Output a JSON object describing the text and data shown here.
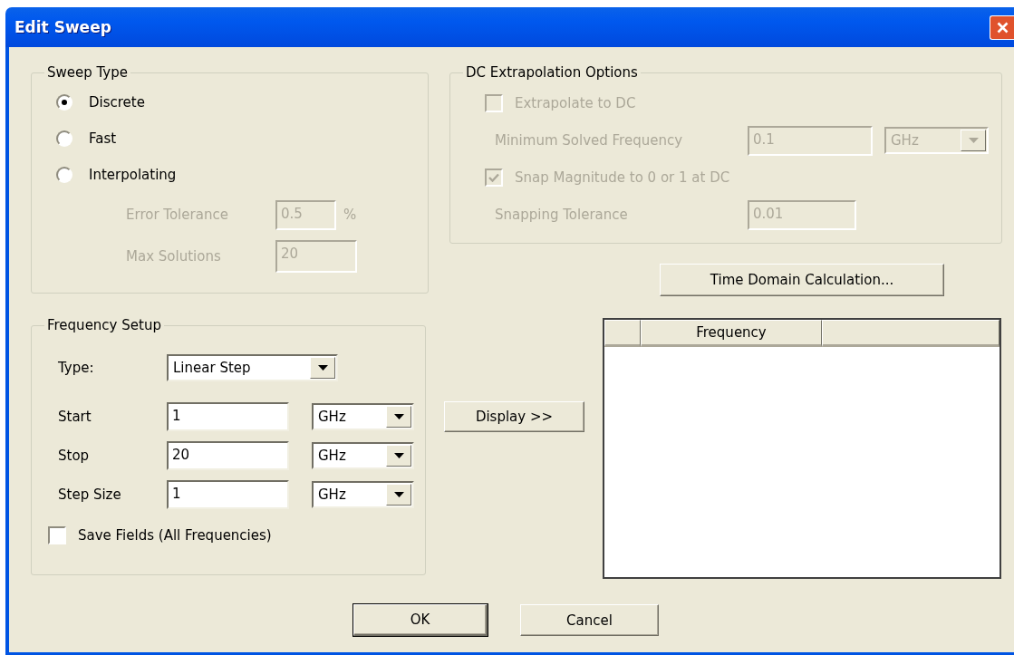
{
  "window": {
    "title": "Edit Sweep"
  },
  "sweep_type": {
    "title": "Sweep Type",
    "options": [
      {
        "label": "Discrete",
        "selected": true
      },
      {
        "label": "Fast",
        "selected": false
      },
      {
        "label": "Interpolating",
        "selected": false
      }
    ],
    "fields": [
      {
        "label": "Error Tolerance",
        "value": "0.5",
        "suffix": "%",
        "disabled": true
      },
      {
        "label": "Max Solutions",
        "value": "20",
        "disabled": true
      }
    ]
  },
  "dc_extrapolation": {
    "title": "DC Extrapolation Options",
    "items": [
      {
        "kind": "checkbox",
        "label": "Extrapolate to DC",
        "checked": false,
        "disabled": true
      },
      {
        "kind": "field",
        "label": "Minimum Solved Frequency",
        "value": "0.1",
        "unit": "GHz",
        "disabled": true
      },
      {
        "kind": "checkbox",
        "label": "Snap Magnitude to 0 or 1 at DC",
        "checked": true,
        "disabled": true
      },
      {
        "kind": "field",
        "label": "Snapping Tolerance",
        "value": "0.01",
        "disabled": true
      }
    ]
  },
  "time_domain_button": "Time Domain Calculation...",
  "frequency_setup": {
    "title": "Frequency Setup",
    "type": {
      "label": "Type:",
      "value": "Linear Step"
    },
    "rows": [
      {
        "label": "Start",
        "value": "1",
        "unit": "GHz"
      },
      {
        "label": "Stop",
        "value": "20",
        "unit": "GHz"
      },
      {
        "label": "Step Size",
        "value": "1",
        "unit": "GHz"
      }
    ],
    "save_fields": {
      "label": "Save Fields (All Frequencies)",
      "checked": false
    }
  },
  "display_button": "Display >>",
  "table": {
    "columns": [
      "Frequency"
    ]
  },
  "buttons": [
    {
      "label": "OK",
      "default": true
    },
    {
      "label": "Cancel",
      "default": false
    }
  ]
}
